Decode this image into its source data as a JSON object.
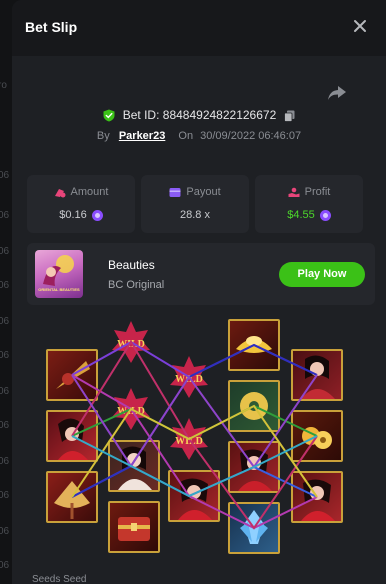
{
  "background_rows": [
    "ro",
    "06",
    "06",
    "06",
    "06",
    "06",
    "06",
    "06",
    "06",
    "06",
    "06",
    "06",
    "06"
  ],
  "header": {
    "title": "Bet Slip",
    "close_icon": "close-icon"
  },
  "bet": {
    "id_label": "Bet ID:",
    "id_value": "88484924822126672",
    "by_label": "By",
    "user": "Parker23",
    "on_label": "On",
    "date": "30/09/2022 06:46:07"
  },
  "stats": {
    "amount": {
      "label": "Amount",
      "value": "$0.16"
    },
    "payout": {
      "label": "Payout",
      "value": "28.8 x"
    },
    "profit": {
      "label": "Profit",
      "value": "$4.55"
    }
  },
  "game": {
    "thumb_text": "ORIENTAL BEAUTIES",
    "name": "Beauties",
    "subtitle": "BC Original",
    "play_label": "Play Now"
  },
  "footer_text": "Seeds Seed",
  "colors": {
    "accent_green": "#3bc117",
    "profit_green": "#4cd62b",
    "coin_purple": "#8a4dff",
    "cell_border": "#c9a13a"
  },
  "reels": {
    "wild_text": "WILD",
    "symbols": [
      [
        "fan",
        "beauty-red",
        "fan"
      ],
      [
        "wild",
        "beauty-white",
        "chest"
      ],
      [
        "wild",
        "wild",
        "beauty-red"
      ],
      [
        "gold-ingot",
        "jade",
        "beauty-red",
        "crystal"
      ],
      [
        "beauty-blue",
        "gold-coins",
        "beauty-red"
      ]
    ]
  }
}
